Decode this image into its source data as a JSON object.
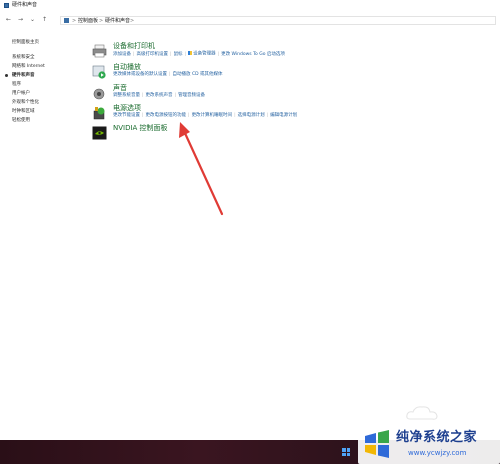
{
  "window": {
    "title": "硬件和声音"
  },
  "address_bar": {
    "back": "←",
    "forward": "→",
    "dropdown": "⌄",
    "up": "↑",
    "crumbs": [
      "控制面板",
      "硬件和声音"
    ],
    "separators": [
      ">",
      ">",
      ">"
    ]
  },
  "sidebar": {
    "items": [
      {
        "label": "控制面板主页",
        "active": false
      },
      {
        "label": "系统和安全",
        "active": false
      },
      {
        "label": "网络和 Internet",
        "active": false
      },
      {
        "label": "硬件和声音",
        "active": true
      },
      {
        "label": "程序",
        "active": false
      },
      {
        "label": "用户帐户",
        "active": false
      },
      {
        "label": "外观和个性化",
        "active": false
      },
      {
        "label": "时钟和区域",
        "active": false
      },
      {
        "label": "轻松使用",
        "active": false
      }
    ]
  },
  "categories": [
    {
      "title": "设备和打印机",
      "icon": "printer-icon",
      "links": [
        "添加设备",
        "高级打印机设置",
        "鼠标",
        "设备管理器",
        "更改 Windows To Go 启动选项"
      ]
    },
    {
      "title": "自动播放",
      "icon": "autoplay-icon",
      "links": [
        "更改媒体或设备的默认设置",
        "自动播放 CD 或其他媒体"
      ]
    },
    {
      "title": "声音",
      "icon": "speaker-icon",
      "links": [
        "调整系统音量",
        "更改系统声音",
        "管理音频设备"
      ]
    },
    {
      "title": "电源选项",
      "icon": "power-options-icon",
      "links": [
        "更改节能设置",
        "更改电源按钮的功能",
        "更改计算机睡眠时间",
        "选择电源计划",
        "编辑电源计划"
      ]
    },
    {
      "title": "NVIDIA 控制面板",
      "icon": "nvidia-icon",
      "links": []
    }
  ],
  "watermark": {
    "title": "纯净系统之家",
    "url": "www.ycwjzy.com"
  },
  "colors": {
    "link": "#1e5d9e",
    "heading": "#1a6b2e",
    "arrow": "#e03b35",
    "taskbar": "#2a0f17"
  }
}
